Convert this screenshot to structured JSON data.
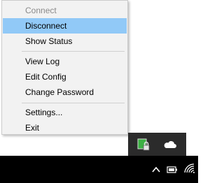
{
  "context_menu": {
    "items": [
      {
        "label": "Connect",
        "disabled": true
      },
      {
        "label": "Disconnect",
        "highlighted": true
      },
      {
        "label": "Show Status"
      },
      {
        "label": "View Log"
      },
      {
        "label": "Edit Config"
      },
      {
        "label": "Change Password"
      },
      {
        "label": "Settings..."
      },
      {
        "label": "Exit"
      }
    ]
  },
  "tray_overflow": {
    "icons": [
      "openvpn-lock-icon",
      "onedrive-cloud-icon"
    ]
  },
  "taskbar": {
    "icons": [
      "show-hidden-icons-chevron-icon",
      "battery-icon",
      "wifi-icon"
    ]
  },
  "colors": {
    "menu_background": "#f2f2f2",
    "highlight": "#91c9f7",
    "disabled_text": "#8a8a8a",
    "taskbar": "#000000",
    "tray_panel": "#2b2b2b",
    "vpn_green": "#3cb043"
  }
}
